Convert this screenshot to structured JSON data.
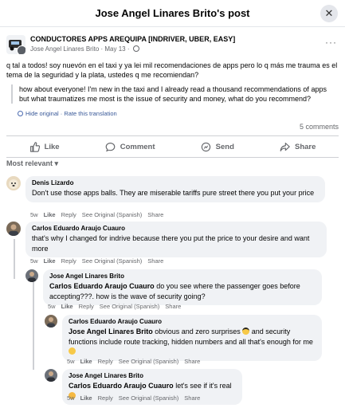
{
  "header": {
    "title": "Jose Angel Linares Brito's post",
    "close": "✕"
  },
  "post": {
    "group_name": "CONDUCTORES APPS AREQUIPA [INDRIVER, UBER, EASY]",
    "author": "Jose Angel Linares Brito",
    "time": " · May 13 · ",
    "more": "···",
    "text": "q tal a todos! soy nuevón en el taxi y ya lei mil recomendaciones de apps pero lo q más me trauma es el tema de la seguridad y la plata, ustedes q me recomiendan?",
    "translation": "how about everyone! I'm new in the taxi and I already read a thousand recommendations of apps but what traumatizes me most is the issue of security and money, what do you recommend?",
    "hide_original": "Hide original",
    "rate_translation": "Rate this translation",
    "comment_count": "5 comments"
  },
  "actions": {
    "like": "Like",
    "comment": "Comment",
    "send": "Send",
    "share": "Share"
  },
  "sort_label": "Most relevant ▾",
  "meta_labels": {
    "like": "Like",
    "reply": "Reply",
    "see_original": "See Original (Spanish)",
    "share": "Share"
  },
  "comments": [
    {
      "author": "Denis Lizardo",
      "text": "Don't use those apps balls. They are miserable tariffs pure street there you put your price",
      "time": "5w"
    },
    {
      "author": "Carlos Eduardo Araujo Cuauro",
      "text": "that's why I changed for indrive because there you put the price to your desire and want more",
      "time": "5w"
    },
    {
      "author": "Jose Angel Linares Brito",
      "tag": "Carlos Eduardo Araujo Cuauro",
      "text": " do you see where the passenger goes before accepting???. how is the wave of security going?",
      "time": "5w"
    },
    {
      "author": "Carlos Eduardo Araujo Cuauro",
      "tag": "Jose Angel Linares Brito",
      "text": " obvious and zero surprises",
      "text2": " and security functions include route tracking, hidden numbers and all that's enough for me ",
      "time": "5w"
    },
    {
      "author": "Jose Angel Linares Brito",
      "tag": "Carlos Eduardo Araujo Cuauro",
      "text": " let's see if it's real ",
      "time": "5w"
    }
  ],
  "colors": {
    "link": "#385898",
    "meta": "#65676b",
    "bubble": "#f0f2f5",
    "divider": "#ced0d4"
  },
  "icons": [
    "close-icon",
    "more-icon",
    "globe-icon",
    "gear-icon",
    "like-icon",
    "comment-icon",
    "send-icon",
    "share-icon",
    "sunglasses-emoji",
    "smile-emoji",
    "clap-emoji"
  ]
}
